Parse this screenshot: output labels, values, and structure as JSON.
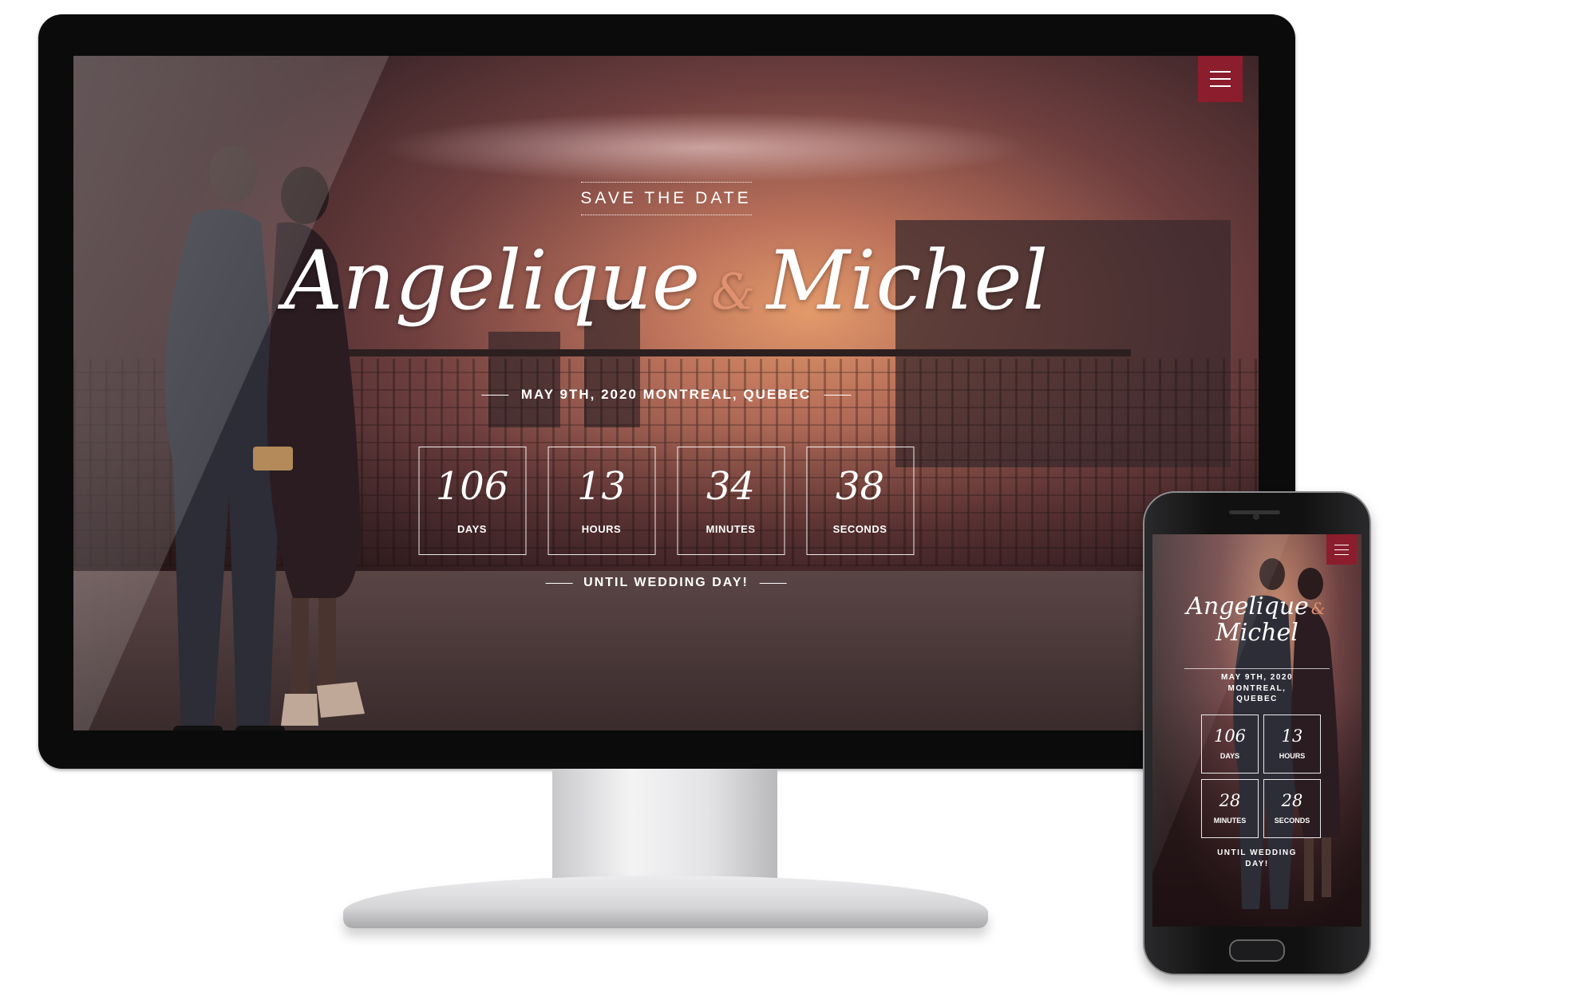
{
  "desktop": {
    "save_the_date": "SAVE THE DATE",
    "name_1": "Angelique",
    "ampersand": "&",
    "name_2": "Michel",
    "date_location": "MAY 9TH, 2020 MONTREAL, QUEBEC",
    "countdown": [
      {
        "value": "106",
        "label": "DAYS"
      },
      {
        "value": "13",
        "label": "HOURS"
      },
      {
        "value": "34",
        "label": "MINUTES"
      },
      {
        "value": "38",
        "label": "SECONDS"
      }
    ],
    "until": "UNTIL WEDDING DAY!"
  },
  "mobile": {
    "name_1": "Angelique",
    "ampersand": "&",
    "name_2": "Michel",
    "date_line_1": "MAY 9TH, 2020",
    "date_line_2": "MONTREAL,",
    "date_line_3": "QUEBEC",
    "countdown": [
      {
        "value": "106",
        "label": "DAYS"
      },
      {
        "value": "13",
        "label": "HOURS"
      },
      {
        "value": "28",
        "label": "MINUTES"
      },
      {
        "value": "28",
        "label": "SECONDS"
      }
    ],
    "until_line_1": "UNTIL WEDDING",
    "until_line_2": "DAY!"
  },
  "colors": {
    "accent": "#8b1d2c",
    "ampersand": "#e09170",
    "text": "#ffffff"
  },
  "icons": {
    "menu": "hamburger-menu-icon"
  }
}
